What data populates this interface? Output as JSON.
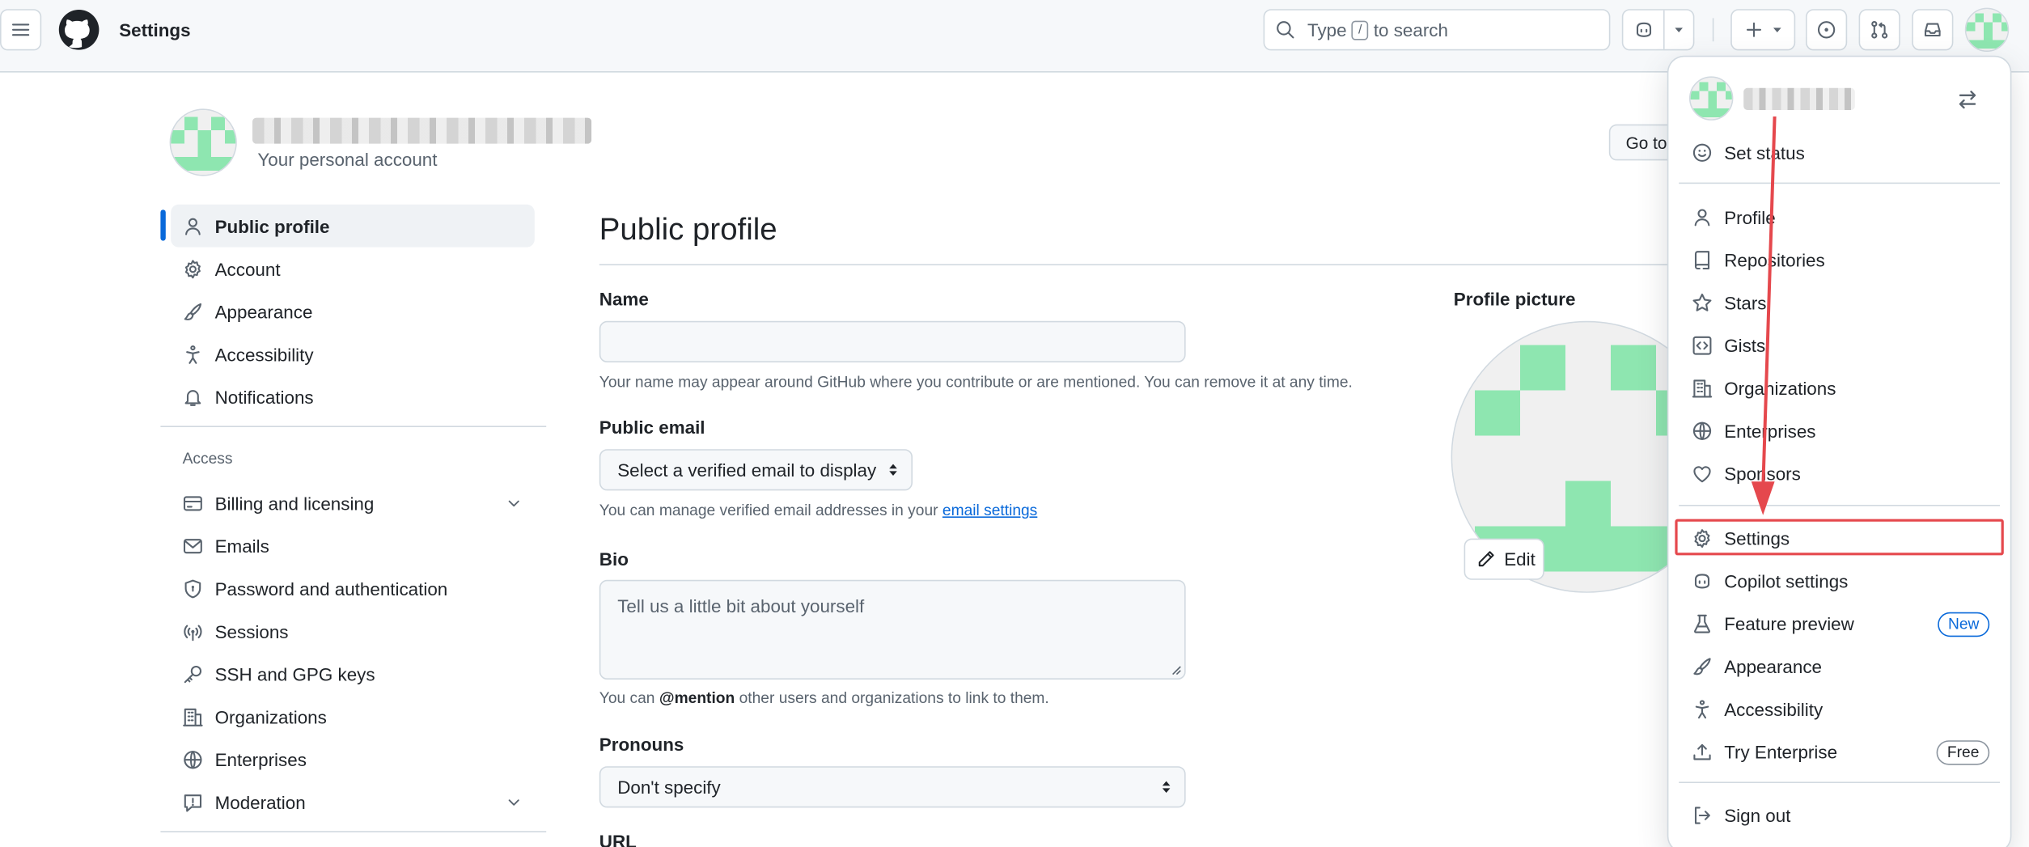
{
  "header": {
    "context_title": "Settings",
    "search_prefix": "Type",
    "search_key": "/",
    "search_suffix": "to search"
  },
  "page_header": {
    "account_subtitle": "Your personal account",
    "goto_button": "Go to your personal profile"
  },
  "sidebar": {
    "items": [
      {
        "label": "Public profile",
        "icon": "person-icon"
      },
      {
        "label": "Account",
        "icon": "gear-icon"
      },
      {
        "label": "Appearance",
        "icon": "paintbrush-icon"
      },
      {
        "label": "Accessibility",
        "icon": "accessibility-icon"
      },
      {
        "label": "Notifications",
        "icon": "bell-icon"
      }
    ],
    "access_heading": "Access",
    "access_items": [
      {
        "label": "Billing and licensing",
        "icon": "credit-card-icon"
      },
      {
        "label": "Emails",
        "icon": "mail-icon"
      },
      {
        "label": "Password and authentication",
        "icon": "shield-lock-icon"
      },
      {
        "label": "Sessions",
        "icon": "broadcast-icon"
      },
      {
        "label": "SSH and GPG keys",
        "icon": "key-icon"
      },
      {
        "label": "Organizations",
        "icon": "organization-icon"
      },
      {
        "label": "Enterprises",
        "icon": "globe-icon"
      },
      {
        "label": "Moderation",
        "icon": "report-icon"
      }
    ]
  },
  "main": {
    "title": "Public profile",
    "name_label": "Name",
    "name_value": "",
    "name_note": "Your name may appear around GitHub where you contribute or are mentioned. You can remove it at any time.",
    "email_label": "Public email",
    "email_select": "Select a verified email to display",
    "email_note_prefix": "You can manage verified email addresses in your",
    "email_note_link": "email settings",
    "bio_label": "Bio",
    "bio_placeholder": "Tell us a little bit about yourself",
    "bio_note_prefix": "You can",
    "bio_note_mention": "@mention",
    "bio_note_suffix": "other users and organizations to link to them.",
    "pronouns_label": "Pronouns",
    "pronouns_select": "Don't specify",
    "url_label": "URL",
    "profile_picture_label": "Profile picture",
    "edit_button": "Edit"
  },
  "user_menu": {
    "set_status": "Set status",
    "group1": [
      {
        "label": "Profile",
        "icon": "person-icon"
      },
      {
        "label": "Repositories",
        "icon": "repo-icon"
      },
      {
        "label": "Stars",
        "icon": "star-icon"
      },
      {
        "label": "Gists",
        "icon": "code-square-icon"
      },
      {
        "label": "Organizations",
        "icon": "organization-icon"
      },
      {
        "label": "Enterprises",
        "icon": "globe-icon"
      },
      {
        "label": "Sponsors",
        "icon": "heart-icon"
      }
    ],
    "group2": [
      {
        "label": "Settings",
        "icon": "gear-icon"
      },
      {
        "label": "Copilot settings",
        "icon": "copilot-icon"
      },
      {
        "label": "Feature preview",
        "icon": "beaker-icon",
        "badge": "New"
      },
      {
        "label": "Appearance",
        "icon": "paintbrush-icon"
      },
      {
        "label": "Accessibility",
        "icon": "accessibility-icon"
      },
      {
        "label": "Try Enterprise",
        "icon": "upload-icon",
        "badge": "Free"
      }
    ],
    "sign_out": "Sign out"
  },
  "colors": {
    "accent": "#0969da",
    "annotation_red": "#e5484d",
    "identicon_green": "#8ee6b0"
  }
}
